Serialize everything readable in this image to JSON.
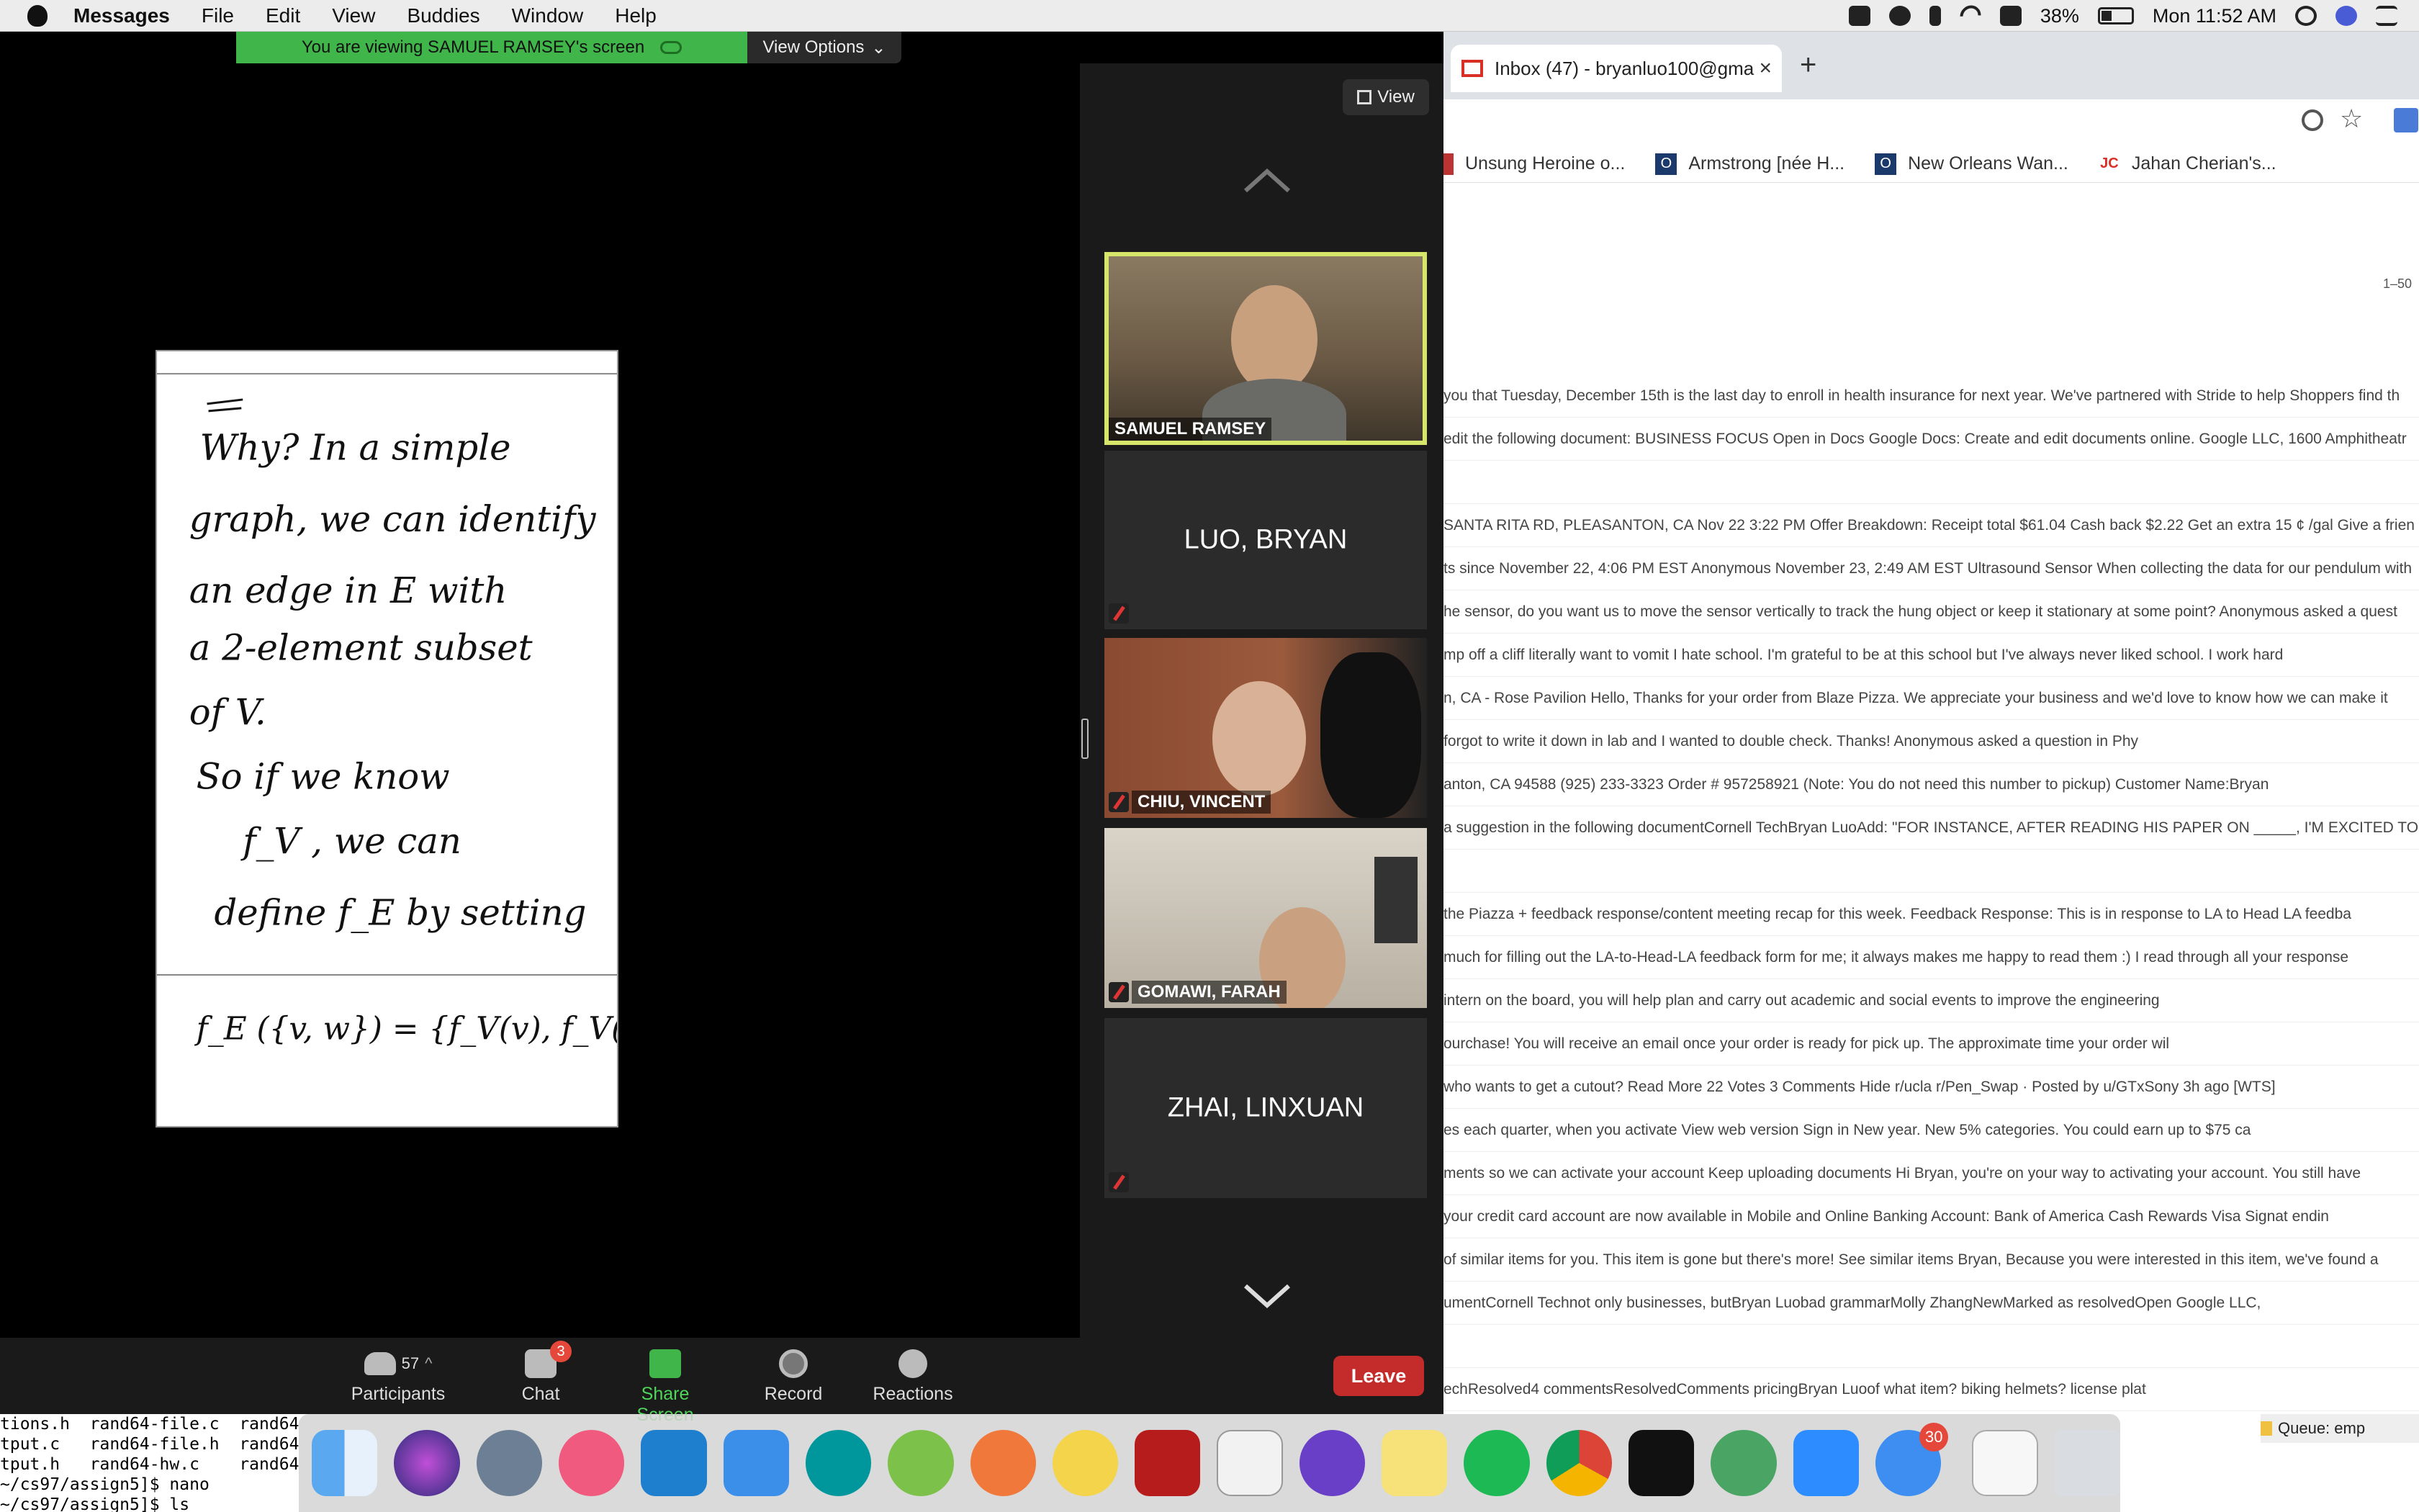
{
  "menubar": {
    "app": "Messages",
    "items": [
      "File",
      "Edit",
      "View",
      "Buddies",
      "Window",
      "Help"
    ],
    "battery": "38%",
    "clock": "Mon 11:52 AM"
  },
  "zoom": {
    "share_banner": "You are viewing SAMUEL RAMSEY's screen",
    "view_options": "View Options",
    "view_button": "View",
    "whiteboard_lines": [
      "Why?  In a simple",
      "graph, we can identify",
      "an edge in E with",
      "a 2-element subset",
      "of V.",
      "So if we know",
      "f_V , we can",
      "define f_E by setting",
      "f_E ({v, w}) = {f_V(v), f_V(w)}"
    ],
    "participants_tiles": [
      {
        "name": "SAMUEL RAMSEY",
        "video": true,
        "active": true
      },
      {
        "name": "LUO, BRYAN",
        "video": false
      },
      {
        "name": "CHIU, VINCENT",
        "video": true
      },
      {
        "name": "GOMAWI, FARAH",
        "video": true
      },
      {
        "name": "ZHAI, LINXUAN",
        "video": false
      }
    ],
    "controls": {
      "participants": "Participants",
      "participants_count": "57",
      "chat": "Chat",
      "chat_badge": "3",
      "share": "Share Screen",
      "record": "Record",
      "reactions": "Reactions",
      "leave": "Leave"
    }
  },
  "chrome": {
    "tab_title": "Inbox (47) - bryanluo100@gma",
    "bookmarks": [
      "Unsung Heroine o...",
      "Armstrong [née H...",
      "New Orleans Wan...",
      "Jahan Cherian's..."
    ],
    "bookmark_jc": "JC",
    "pager": "1–50",
    "rows": [
      "you that Tuesday, December 15th is the last day to enroll in health insurance for next year. We've partnered with Stride to help Shoppers find th",
      "edit the following document: BUSINESS FOCUS Open in Docs Google Docs: Create and edit documents online. Google LLC, 1600 Amphitheatr",
      "",
      "SANTA RITA RD, PLEASANTON, CA Nov 22 3:22 PM Offer Breakdown: Receipt total $61.04 Cash back $2.22 Get an extra 15 ¢ /gal Give a frien",
      "ts since November 22, 4:06 PM EST Anonymous November 23, 2:49 AM EST Ultrasound Sensor When collecting the data for our pendulum with",
      "he sensor, do you want us to move the sensor vertically to track the hung object or keep it stationary at some point? Anonymous asked a quest",
      "mp off a cliff literally want to vomit I hate school. I'm grateful to be at this school but I've always never liked school. I work hard",
      "n, CA - Rose Pavilion Hello, Thanks for your order from Blaze Pizza. We appreciate your business and we'd love to know how we can make it",
      "forgot to write it down in lab and I wanted to double check. Thanks! Anonymous asked a question in Phy",
      "anton, CA 94588 (925) 233-3323 Order # 957258921 (Note: You do not need this number to pickup) Customer Name:Bryan",
      "a suggestion in the following documentCornell TechBryan LuoAdd: \"FOR INSTANCE, AFTER READING HIS PAPER ON _____, I'M EXCITED TO DIS",
      "",
      "the Piazza + feedback response/content meeting recap for this week. Feedback Response: This is in response to LA to Head LA feedba",
      "much for filling out the LA-to-Head-LA feedback form for me; it always makes me happy to read them :) I read through all your response",
      "intern on the board, you will help plan and carry out academic and social events to improve the engineering",
      "ourchase! You will receive an email once your order is ready for pick up. The approximate time your order wil",
      "who wants to get a cutout? Read More 22 Votes 3 Comments Hide r/ucla r/Pen_Swap · Posted by u/GTxSony 3h ago [WTS]",
      "es each quarter, when you activate View web version Sign in New year. New 5% categories. You could earn up to $75 ca",
      "ments so we can activate your account Keep uploading documents Hi Bryan, you're on your way to activating your account. You still have",
      "your credit card account are now available in Mobile and Online Banking Account: Bank of America Cash Rewards Visa Signat endin",
      "of similar items for you. This item is gone but there's more! See similar items Bryan, Because you were interested in this item, we've found a",
      "umentCornell Technot only businesses, butBryan Luobad grammarMolly ZhangNewMarked as resolvedOpen Google LLC,",
      "",
      "echResolved4 commentsResolvedComments pricingBryan Luoof what item? biking helmets? license plat"
    ],
    "queue": "Queue: emp"
  },
  "terminal": {
    "lines": [
      "tions.h  rand64-file.c  rand64",
      "tput.c   rand64-file.h  rand64",
      "tput.h   rand64-hw.c    rand64",
      "~/cs97/assign5]$ nano",
      "~/cs97/assign5]$ ls"
    ]
  },
  "dock": {
    "messages_badge": "30"
  }
}
